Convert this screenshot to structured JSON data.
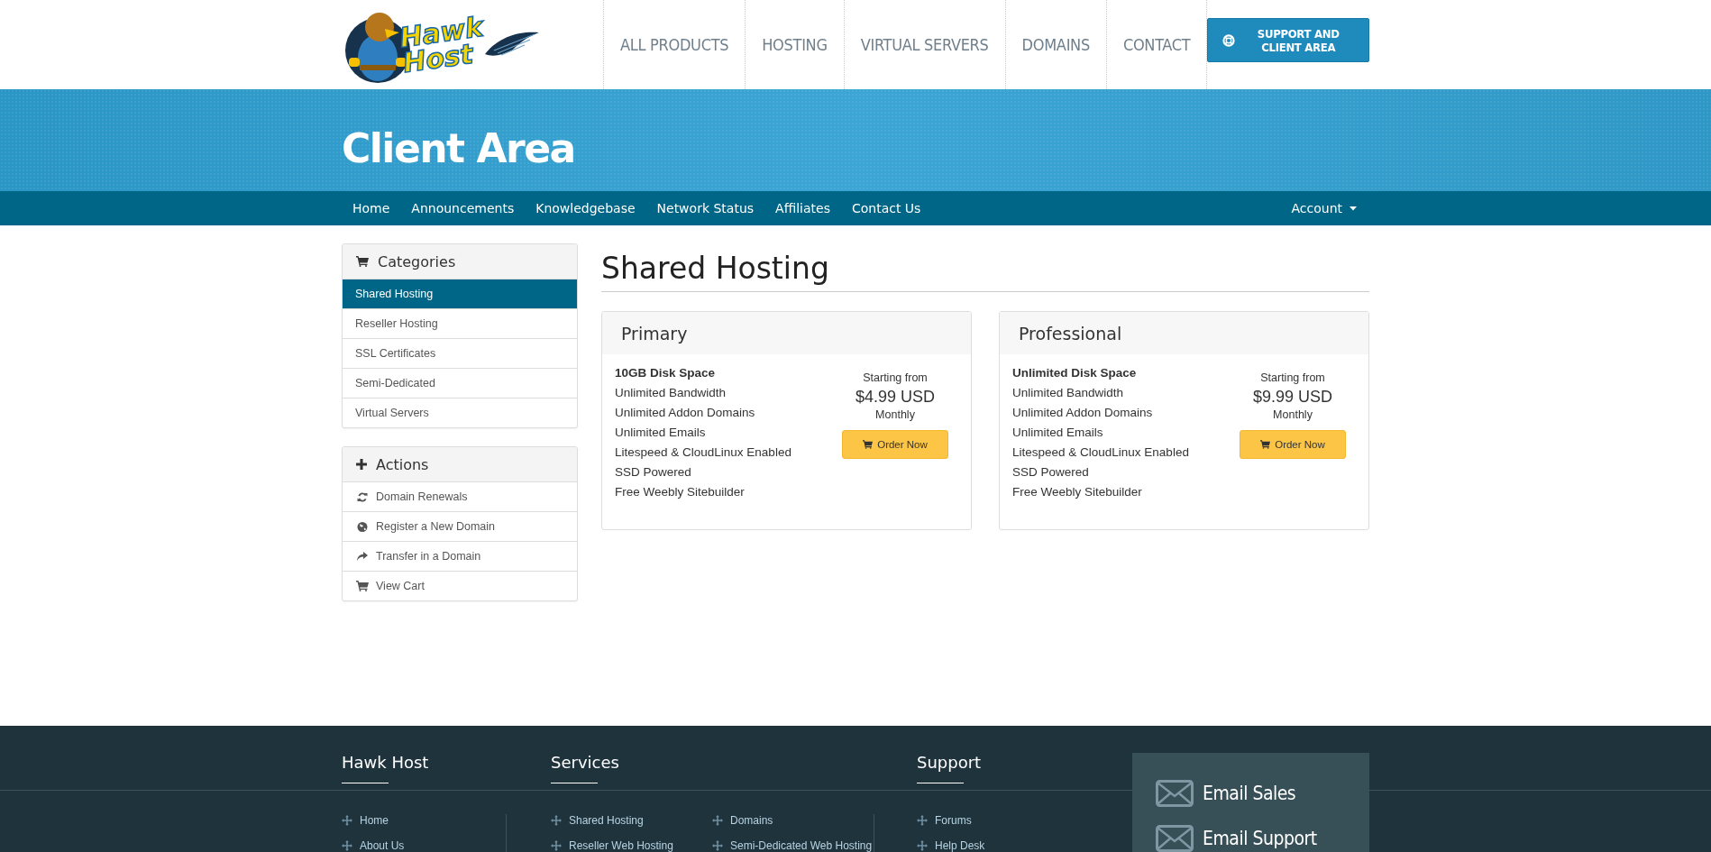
{
  "header": {
    "logo": {
      "word_1": "Hawk",
      "word_2": "Host"
    },
    "nav": [
      "ALL PRODUCTS",
      "HOSTING",
      "VIRTUAL SERVERS",
      "DOMAINS",
      "CONTACT"
    ],
    "support_button": "SUPPORT AND CLIENT AREA"
  },
  "banner": {
    "title": "Client Area"
  },
  "subnav": {
    "items": [
      "Home",
      "Announcements",
      "Knowledgebase",
      "Network Status",
      "Affiliates",
      "Contact Us"
    ],
    "account": "Account"
  },
  "sidebar": {
    "panels": [
      {
        "title": "Categories",
        "kind": "cart",
        "items": [
          {
            "label": "Shared Hosting",
            "selected": true
          },
          {
            "label": "Reseller Hosting",
            "selected": false
          },
          {
            "label": "SSL Certificates",
            "selected": false
          },
          {
            "label": "Semi-Dedicated",
            "selected": false
          },
          {
            "label": "Virtual Servers",
            "selected": false
          }
        ]
      },
      {
        "title": "Actions",
        "kind": "plus",
        "items": [
          {
            "label": "Domain Renewals",
            "kind": "refresh"
          },
          {
            "label": "Register a New Domain",
            "kind": "globe"
          },
          {
            "label": "Transfer in a Domain",
            "kind": "share"
          },
          {
            "label": "View Cart",
            "kind": "cart"
          }
        ]
      }
    ]
  },
  "main": {
    "title": "Shared Hosting",
    "products": [
      {
        "name": "Primary",
        "features": [
          {
            "text": "10GB Disk Space",
            "bold": true
          },
          {
            "text": "Unlimited Bandwidth",
            "bold": false
          },
          {
            "text": "Unlimited Addon Domains",
            "bold": false
          },
          {
            "text": "Unlimited Emails",
            "bold": false
          },
          {
            "text": "Litespeed & CloudLinux Enabled",
            "bold": false
          },
          {
            "text": "SSD Powered",
            "bold": false
          },
          {
            "text": "Free Weebly Sitebuilder",
            "bold": false
          }
        ],
        "starting": "Starting from",
        "price": "$4.99 USD",
        "cycle": "Monthly",
        "button": "Order Now"
      },
      {
        "name": "Professional",
        "features": [
          {
            "text": "Unlimited Disk Space",
            "bold": true
          },
          {
            "text": "Unlimited Bandwidth",
            "bold": false
          },
          {
            "text": "Unlimited Addon Domains",
            "bold": false
          },
          {
            "text": "Unlimited Emails",
            "bold": false
          },
          {
            "text": "Litespeed & CloudLinux Enabled",
            "bold": false
          },
          {
            "text": "SSD Powered",
            "bold": false
          },
          {
            "text": "Free Weebly Sitebuilder",
            "bold": false
          }
        ],
        "starting": "Starting from",
        "price": "$9.99 USD",
        "cycle": "Monthly",
        "button": "Order Now"
      }
    ]
  },
  "footer": {
    "sections": [
      {
        "title": "Hawk Host",
        "lists": [
          [
            "Home",
            "About Us"
          ]
        ]
      },
      {
        "title": "Services",
        "lists": [
          [
            "Shared Hosting",
            "Reseller Web Hosting"
          ],
          [
            "Domains",
            "Semi-Dedicated Web Hosting"
          ]
        ]
      },
      {
        "title": "Support",
        "lists": [
          [
            "Forums",
            "Help Desk"
          ]
        ]
      }
    ],
    "contact": [
      "Email Sales",
      "Email Support"
    ]
  }
}
